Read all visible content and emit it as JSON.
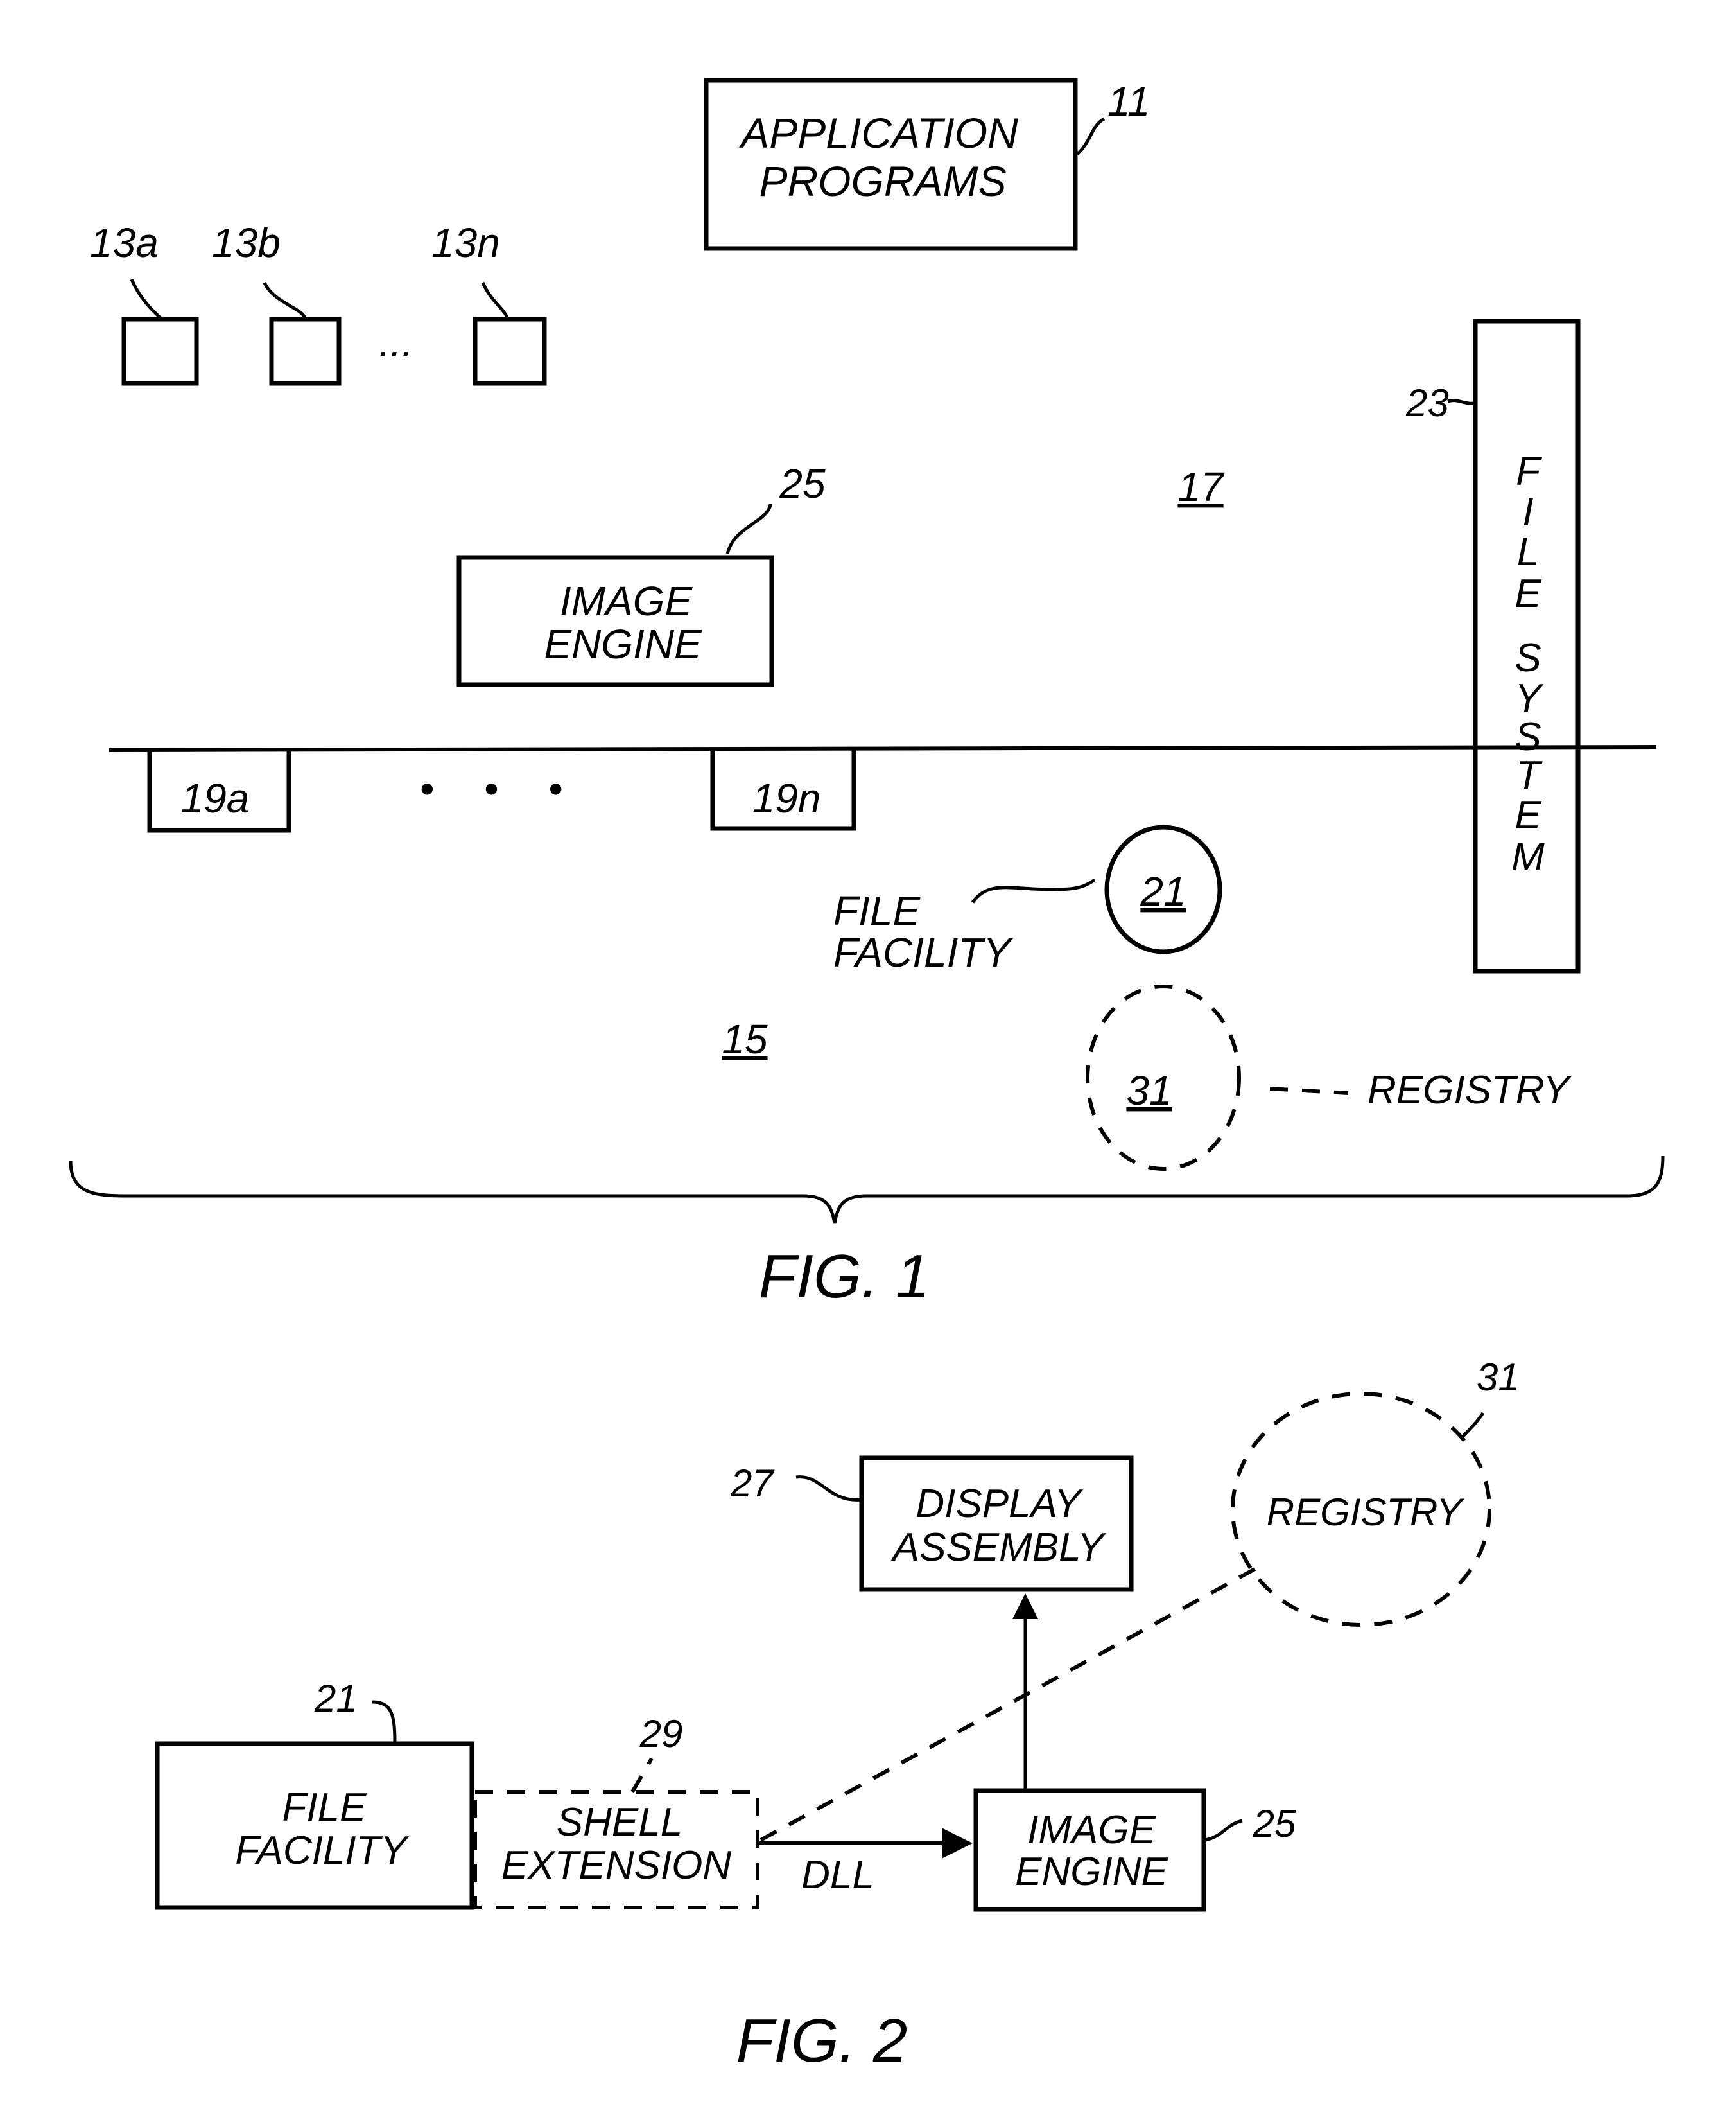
{
  "fig1": {
    "caption": "FIG. 1",
    "application_programs": {
      "line1": "APPLICATION",
      "line2": "PROGRAMS",
      "ref": "11"
    },
    "peripherals": [
      {
        "ref": "13a"
      },
      {
        "ref": "13b"
      },
      {
        "ref": "13n"
      }
    ],
    "peripheral_ellipsis": "...",
    "image_engine": {
      "line1": "IMAGE",
      "line2": "ENGINE",
      "ref": "25"
    },
    "region_upper_ref": "17",
    "region_lower_ref": "15",
    "drivers": [
      {
        "ref": "19a"
      },
      {
        "ref": "19n"
      }
    ],
    "driver_ellipsis": "• • •",
    "file_system": {
      "letters": [
        "F",
        "I",
        "L",
        "E",
        "S",
        "Y",
        "S",
        "T",
        "E",
        "M"
      ],
      "ref": "23"
    },
    "file_facility": {
      "line1": "FILE",
      "line2": "FACILITY",
      "ref": "21"
    },
    "registry": {
      "label": "REGISTRY",
      "ref": "31"
    }
  },
  "fig2": {
    "caption": "FIG. 2",
    "display_assembly": {
      "line1": "DISPLAY",
      "line2": "ASSEMBLY",
      "ref": "27"
    },
    "registry": {
      "label": "REGISTRY",
      "ref": "31"
    },
    "file_facility": {
      "line1": "FILE",
      "line2": "FACILITY",
      "ref": "21"
    },
    "shell_extension": {
      "line1": "SHELL",
      "line2": "EXTENSION",
      "ref": "29"
    },
    "image_engine": {
      "line1": "IMAGE",
      "line2": "ENGINE",
      "ref": "25"
    },
    "connector_label": "DLL"
  }
}
